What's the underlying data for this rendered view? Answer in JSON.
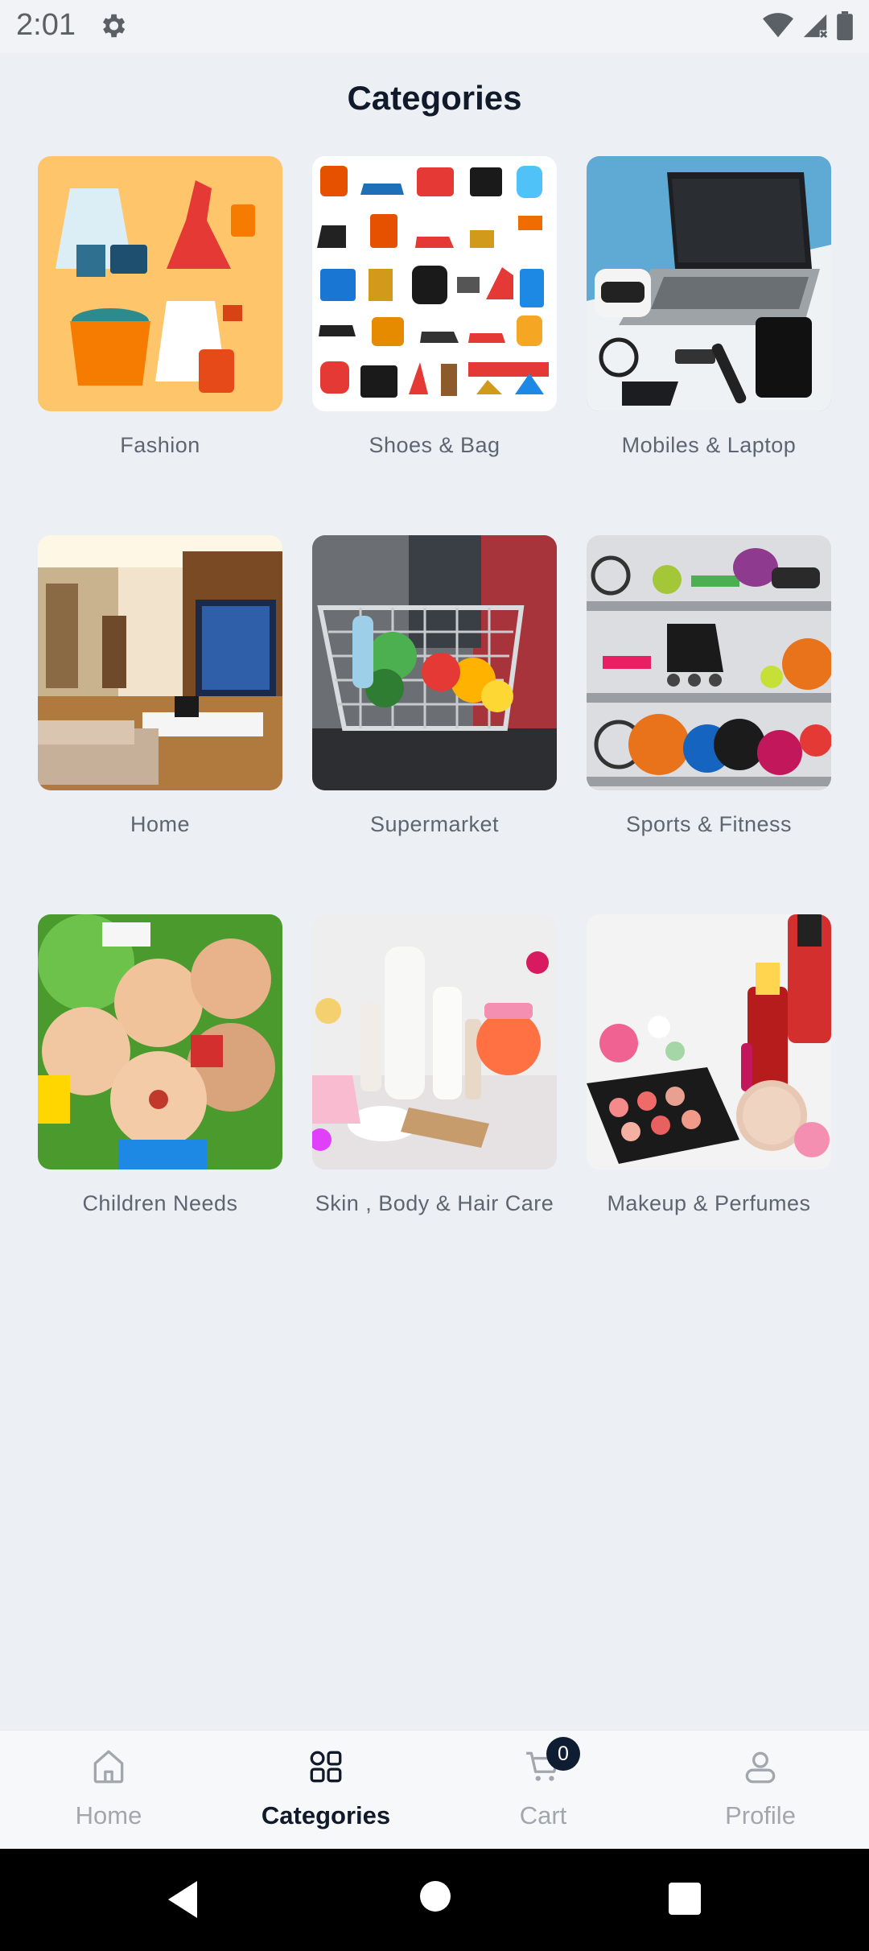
{
  "status_bar": {
    "time": "2:01",
    "icons": [
      "gear-icon",
      "wifi-icon",
      "signal-icon",
      "battery-icon"
    ]
  },
  "header": {
    "title": "Categories"
  },
  "categories": [
    {
      "label": "Fashion",
      "image": "fashion-image"
    },
    {
      "label": "Shoes & Bag",
      "image": "shoes-bags-image"
    },
    {
      "label": "Mobiles & Laptop",
      "image": "laptop-devices-image"
    },
    {
      "label": "Home",
      "image": "living-room-image"
    },
    {
      "label": "Supermarket",
      "image": "shopping-cart-image"
    },
    {
      "label": "Sports & Fitness",
      "image": "sports-equipment-image"
    },
    {
      "label": "Children Needs",
      "image": "children-image"
    },
    {
      "label": "Skin , Body & Hair Care",
      "image": "skincare-image"
    },
    {
      "label": "Makeup & Perfumes",
      "image": "makeup-image"
    }
  ],
  "bottom_nav": {
    "items": [
      {
        "label": "Home",
        "icon": "home-icon",
        "active": false
      },
      {
        "label": "Categories",
        "icon": "categories-icon",
        "active": true
      },
      {
        "label": "Cart",
        "icon": "cart-icon",
        "active": false,
        "badge": "0"
      },
      {
        "label": "Profile",
        "icon": "profile-icon",
        "active": false
      }
    ]
  },
  "colors": {
    "background": "#ecf0f5",
    "title": "#101a2a",
    "label": "#5e6570",
    "nav_inactive": "#a2a7ae",
    "badge": "#0f1d33"
  }
}
